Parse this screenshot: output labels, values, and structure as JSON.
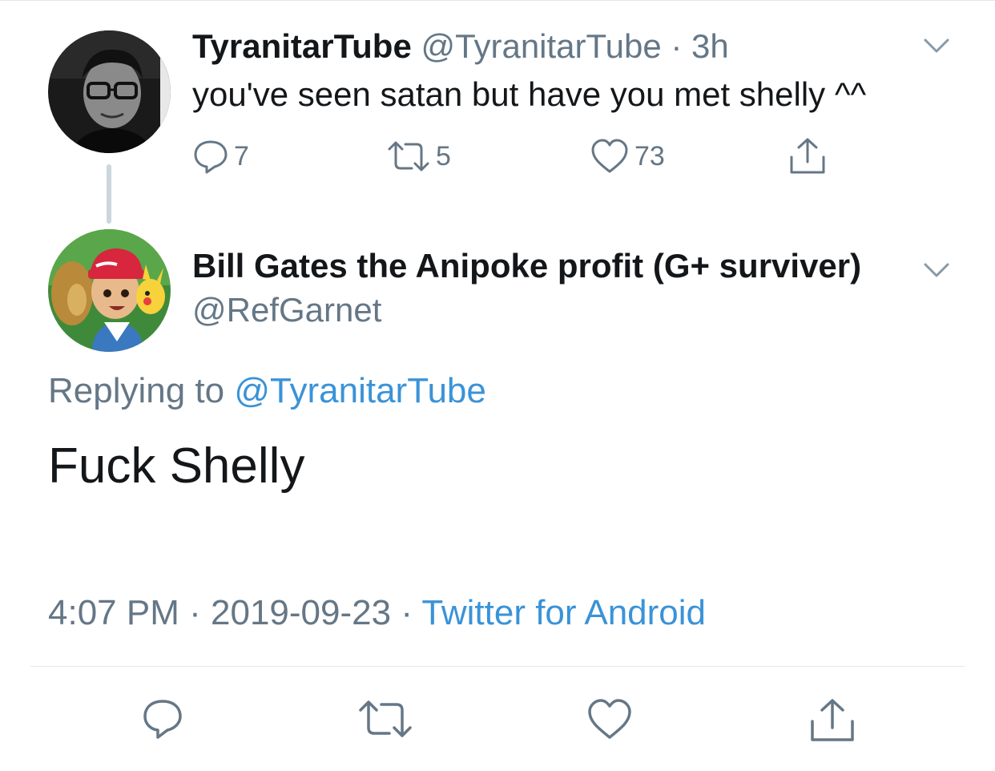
{
  "parent_tweet": {
    "author_name": "TyranitarTube",
    "handle": "@TyranitarTube",
    "separator": "·",
    "time": "3h",
    "text": "you've seen satan but have you met shelly ^^",
    "reply_count": "7",
    "retweet_count": "5",
    "like_count": "73",
    "avatar_icon": "grayscale-profile-photo"
  },
  "main_tweet": {
    "author_name": "Bill Gates the Anipoke profit (G+ surviver)",
    "handle": "@RefGarnet",
    "replying_prefix": "Replying to",
    "replying_to": "@TyranitarTube",
    "text": "Fuck Shelly",
    "time": "4:07 PM",
    "date": "2019-09-23",
    "separator": "·",
    "source": "Twitter for Android",
    "avatar_icon": "anime-character-avatar"
  },
  "icons": {
    "reply": "reply-icon",
    "retweet": "retweet-icon",
    "like": "heart-icon",
    "share": "share-icon",
    "more": "chevron-down-icon"
  },
  "colors": {
    "link": "#3a93d8",
    "secondary_text": "#657786",
    "primary_text": "#14171a",
    "divider": "#e1e8ed",
    "thread_line": "#ccd6dd"
  }
}
